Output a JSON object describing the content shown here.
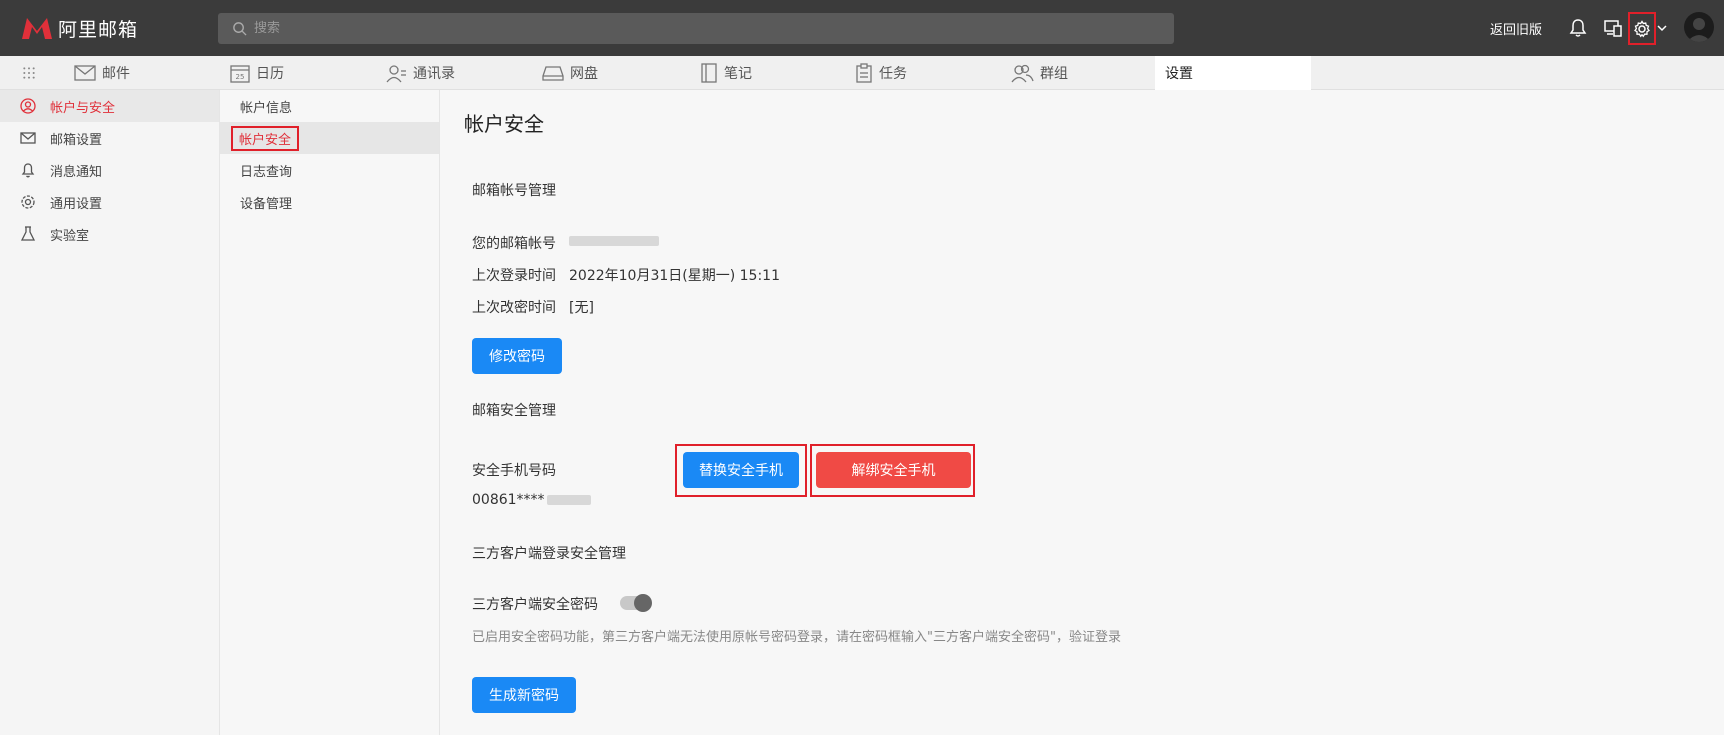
{
  "app": {
    "logo_text": "阿里邮箱",
    "brand_color": "#e0303a"
  },
  "topbar": {
    "search_placeholder": "搜索",
    "old_version": "返回旧版",
    "icons": [
      "search-icon",
      "bell-icon",
      "devices-icon",
      "gear-icon",
      "chevron-down-icon",
      "avatar"
    ]
  },
  "nav": {
    "tabs": [
      {
        "label": "邮件",
        "icon": "mail-icon"
      },
      {
        "label": "日历",
        "icon": "calendar-icon"
      },
      {
        "label": "通讯录",
        "icon": "contacts-icon"
      },
      {
        "label": "网盘",
        "icon": "drive-icon"
      },
      {
        "label": "笔记",
        "icon": "notes-icon"
      },
      {
        "label": "任务",
        "icon": "tasks-icon"
      },
      {
        "label": "群组",
        "icon": "groups-icon"
      },
      {
        "label": "设置",
        "icon": ""
      }
    ],
    "active": "设置"
  },
  "sidebar": {
    "items": [
      {
        "label": "帐户与安全",
        "icon": "user-icon",
        "active": true
      },
      {
        "label": "邮箱设置",
        "icon": "mail-settings-icon",
        "active": false
      },
      {
        "label": "消息通知",
        "icon": "bell-icon",
        "active": false
      },
      {
        "label": "通用设置",
        "icon": "gear-icon",
        "active": false
      },
      {
        "label": "实验室",
        "icon": "flask-icon",
        "active": false
      }
    ]
  },
  "subnav": {
    "items": [
      {
        "label": "帐户信息",
        "active": false
      },
      {
        "label": "帐户安全",
        "active": true
      },
      {
        "label": "日志查询",
        "active": false
      },
      {
        "label": "设备管理",
        "active": false
      }
    ]
  },
  "main": {
    "title": "帐户安全",
    "account_section": {
      "title": "邮箱帐号管理",
      "email_label": "您的邮箱帐号",
      "last_login_label": "上次登录时间",
      "last_login_value": "2022年10月31日(星期一) 15:11",
      "last_pwd_label": "上次改密时间",
      "last_pwd_value": "[无]",
      "change_pwd_button": "修改密码"
    },
    "security_section": {
      "title": "邮箱安全管理",
      "phone_label": "安全手机号码",
      "phone_value": "00861****",
      "replace_button": "替换安全手机",
      "unbind_button": "解绑安全手机"
    },
    "third_party_section": {
      "title": "三方客户端登录安全管理",
      "toggle_label": "三方客户端安全密码",
      "toggle_on": true,
      "hint": "已启用安全密码功能，第三方客户端无法使用原帐号密码登录，请在密码框输入\"三方客户端安全密码\"，验证登录",
      "generate_button": "生成新密码"
    }
  }
}
